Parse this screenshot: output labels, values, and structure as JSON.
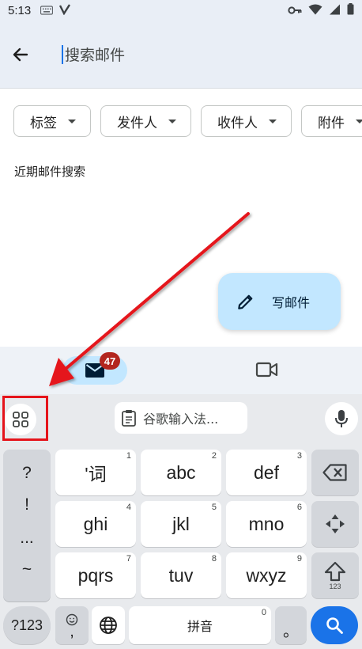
{
  "status_bar": {
    "time": "5:13"
  },
  "search": {
    "placeholder": "搜索邮件"
  },
  "chips": [
    {
      "label": "标签"
    },
    {
      "label": "发件人"
    },
    {
      "label": "收件人"
    },
    {
      "label": "附件"
    }
  ],
  "recent": {
    "label": "近期邮件搜索"
  },
  "compose": {
    "label": "写邮件"
  },
  "bottom_nav": {
    "mail_badge": "47"
  },
  "keyboard": {
    "ime_label": "谷歌输入法...",
    "punctuation": [
      "?",
      "!",
      "...",
      "~"
    ],
    "keys": [
      {
        "label": "'词",
        "num": "1"
      },
      {
        "label": "abc",
        "num": "2"
      },
      {
        "label": "def",
        "num": "3"
      },
      {
        "label": "ghi",
        "num": "4"
      },
      {
        "label": "jkl",
        "num": "5"
      },
      {
        "label": "mno",
        "num": "6"
      },
      {
        "label": "pqrs",
        "num": "7"
      },
      {
        "label": "tuv",
        "num": "8"
      },
      {
        "label": "wxyz",
        "num": "9"
      }
    ],
    "shift_sub": "123",
    "symbols_label": "?123",
    "emoji_comma": ",",
    "space_label": "拼音",
    "space_num": "0",
    "period": "。"
  },
  "colors": {
    "accent": "#1a73e8",
    "compose_bg": "#c2e7ff",
    "badge_bg": "#b3261e",
    "highlight": "#e5141b"
  }
}
